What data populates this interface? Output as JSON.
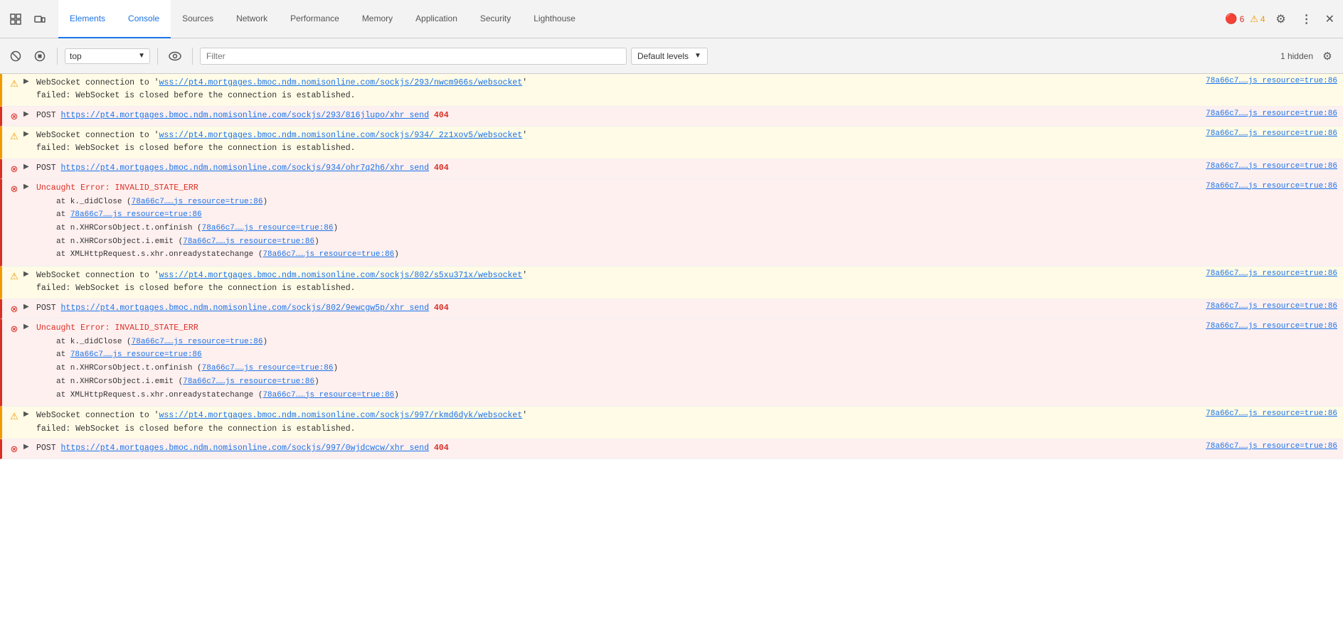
{
  "tabs": [
    {
      "label": "Elements",
      "active": false
    },
    {
      "label": "Console",
      "active": true
    },
    {
      "label": "Sources",
      "active": false
    },
    {
      "label": "Network",
      "active": false
    },
    {
      "label": "Performance",
      "active": false
    },
    {
      "label": "Memory",
      "active": false
    },
    {
      "label": "Application",
      "active": false
    },
    {
      "label": "Security",
      "active": false
    },
    {
      "label": "Lighthouse",
      "active": false
    }
  ],
  "toolbar": {
    "context": "top",
    "filter_placeholder": "Filter",
    "levels_label": "Default levels",
    "hidden_label": "1 hidden"
  },
  "badge": {
    "errors": "6",
    "warnings": "4"
  },
  "source_ref": "78a66c7……js resource=true:86",
  "entries": [
    {
      "type": "warn",
      "text": "WebSocket connection to 'wss://pt4.mortgages.bmoc.ndm.nomisonline.com/sockjs/293/nwcm966s/websocket'\nfailed: WebSocket is closed before the connection is established.",
      "url": "wss://pt4.mortgages.bmoc.ndm.nomisonline.com/sockjs/293/nwcm966s/websocket",
      "source": "78a66c7……js resource=true:86"
    },
    {
      "type": "error",
      "text_before": "POST ",
      "url": "https://pt4.mortgages.bmoc.ndm.nomisonline.com/sockjs/293/816jlupo/xhr send",
      "text_after": " 404",
      "source": "78a66c7……js resource=true:86"
    },
    {
      "type": "warn",
      "text": "WebSocket connection to 'wss://pt4.mortgages.bmoc.ndm.nomisonline.com/sockjs/934/ 2z1xov5/websocket'\nfailed: WebSocket is closed before the connection is established.",
      "url": "wss://pt4.mortgages.bmoc.ndm.nomisonline.com/sockjs/934/ 2z1xov5/websocket",
      "source": "78a66c7……js resource=true:86"
    },
    {
      "type": "error",
      "text_before": "POST ",
      "url": "https://pt4.mortgages.bmoc.ndm.nomisonline.com/sockjs/934/ohr7q2h6/xhr send",
      "text_after": " 404",
      "source": "78a66c7……js resource=true:86"
    },
    {
      "type": "error",
      "kind": "uncaught",
      "title": "Uncaught Error: INVALID_STATE_ERR",
      "stack": [
        {
          "text": "at k._didClose (",
          "link": "78a66c7……js resource=true:86",
          "suffix": ")"
        },
        {
          "text": "at ",
          "link": "78a66c7……js resource=true:86",
          "suffix": ""
        },
        {
          "text": "at n.XHRCorsObject.t.onfinish (",
          "link": "78a66c7……js resource=true:86",
          "suffix": ")"
        },
        {
          "text": "at n.XHRCorsObject.i.emit (",
          "link": "78a66c7……js resource=true:86",
          "suffix": ")"
        },
        {
          "text": "at XMLHttpRequest.s.xhr.onreadystatechange (",
          "link": "78a66c7……js resource=true:86",
          "suffix": ")"
        }
      ],
      "source": "78a66c7……js resource=true:86"
    },
    {
      "type": "warn",
      "text": "WebSocket connection to 'wss://pt4.mortgages.bmoc.ndm.nomisonline.com/sockjs/802/s5xu371x/websocket'\nfailed: WebSocket is closed before the connection is established.",
      "url": "wss://pt4.mortgages.bmoc.ndm.nomisonline.com/sockjs/802/s5xu371x/websocket",
      "source": "78a66c7……js resource=true:86"
    },
    {
      "type": "error",
      "text_before": "POST ",
      "url": "https://pt4.mortgages.bmoc.ndm.nomisonline.com/sockjs/802/9ewcgw5p/xhr send",
      "text_after": " 404",
      "source": "78a66c7……js resource=true:86"
    },
    {
      "type": "error",
      "kind": "uncaught",
      "title": "Uncaught Error: INVALID_STATE_ERR",
      "stack": [
        {
          "text": "at k._didClose (",
          "link": "78a66c7……js resource=true:86",
          "suffix": ")"
        },
        {
          "text": "at ",
          "link": "78a66c7……js resource=true:86",
          "suffix": ""
        },
        {
          "text": "at n.XHRCorsObject.t.onfinish (",
          "link": "78a66c7……js resource=true:86",
          "suffix": ")"
        },
        {
          "text": "at n.XHRCorsObject.i.emit (",
          "link": "78a66c7……js resource=true:86",
          "suffix": ")"
        },
        {
          "text": "at XMLHttpRequest.s.xhr.onreadystatechange (",
          "link": "78a66c7……js resource=true:86",
          "suffix": ")"
        }
      ],
      "source": "78a66c7……js resource=true:86"
    },
    {
      "type": "warn",
      "text": "WebSocket connection to 'wss://pt4.mortgages.bmoc.ndm.nomisonline.com/sockjs/997/rkmd6dyk/websocket'\nfailed: WebSocket is closed before the connection is established.",
      "url": "wss://pt4.mortgages.bmoc.ndm.nomisonline.com/sockjs/997/rkmd6dyk/websocket",
      "source": "78a66c7……js resource=true:86"
    },
    {
      "type": "error",
      "text_before": "POST ",
      "url": "https://pt4.mortgages.bmoc.ndm.nomisonline.com/sockjs/997/0wjdcwcw/xhr send",
      "text_after": " 404",
      "source": "78a66c7……js resource=true:86"
    }
  ]
}
